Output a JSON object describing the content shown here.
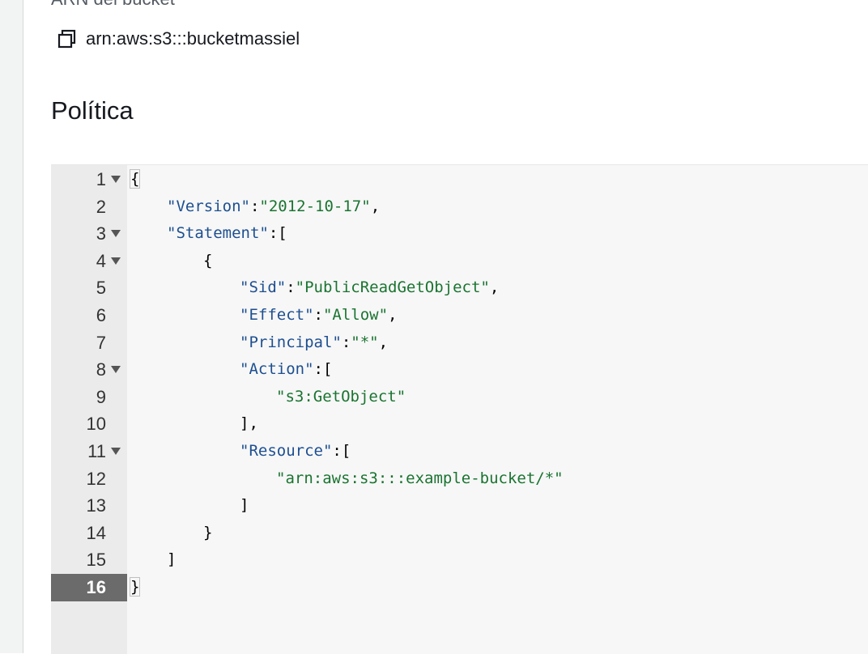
{
  "bucket_arn": {
    "label": "ARN del bucket",
    "value": "arn:aws:s3:::bucketmassiel",
    "copy_icon": "copy-icon"
  },
  "policy": {
    "title": "Política",
    "editor": {
      "active_line": 16,
      "lines": [
        {
          "n": "1",
          "fold": true,
          "indent": 0,
          "parts": [
            {
              "t": "{",
              "c": "brace"
            }
          ]
        },
        {
          "n": "2",
          "fold": false,
          "indent": 1,
          "parts": [
            {
              "t": "\"Version\"",
              "c": "key"
            },
            {
              "t": ":",
              "c": ""
            },
            {
              "t": "\"2012-10-17\"",
              "c": "str"
            },
            {
              "t": ",",
              "c": ""
            }
          ]
        },
        {
          "n": "3",
          "fold": true,
          "indent": 1,
          "parts": [
            {
              "t": "\"Statement\"",
              "c": "key"
            },
            {
              "t": ":[",
              "c": ""
            }
          ]
        },
        {
          "n": "4",
          "fold": true,
          "indent": 2,
          "parts": [
            {
              "t": "{",
              "c": ""
            }
          ]
        },
        {
          "n": "5",
          "fold": false,
          "indent": 3,
          "parts": [
            {
              "t": "\"Sid\"",
              "c": "key"
            },
            {
              "t": ":",
              "c": ""
            },
            {
              "t": "\"PublicReadGetObject\"",
              "c": "str"
            },
            {
              "t": ",",
              "c": ""
            }
          ]
        },
        {
          "n": "6",
          "fold": false,
          "indent": 3,
          "parts": [
            {
              "t": "\"Effect\"",
              "c": "key"
            },
            {
              "t": ":",
              "c": ""
            },
            {
              "t": "\"Allow\"",
              "c": "str"
            },
            {
              "t": ",",
              "c": ""
            }
          ]
        },
        {
          "n": "7",
          "fold": false,
          "indent": 3,
          "parts": [
            {
              "t": "\"Principal\"",
              "c": "key"
            },
            {
              "t": ":",
              "c": ""
            },
            {
              "t": "\"*\"",
              "c": "str"
            },
            {
              "t": ",",
              "c": ""
            }
          ]
        },
        {
          "n": "8",
          "fold": true,
          "indent": 3,
          "parts": [
            {
              "t": "\"Action\"",
              "c": "key"
            },
            {
              "t": ":[",
              "c": ""
            }
          ]
        },
        {
          "n": "9",
          "fold": false,
          "indent": 4,
          "parts": [
            {
              "t": "\"s3:GetObject\"",
              "c": "str"
            }
          ]
        },
        {
          "n": "10",
          "fold": false,
          "indent": 3,
          "parts": [
            {
              "t": "],",
              "c": ""
            }
          ]
        },
        {
          "n": "11",
          "fold": true,
          "indent": 3,
          "parts": [
            {
              "t": "\"Resource\"",
              "c": "key"
            },
            {
              "t": ":[",
              "c": ""
            }
          ]
        },
        {
          "n": "12",
          "fold": false,
          "indent": 4,
          "parts": [
            {
              "t": "\"arn:aws:s3:::example-bucket/*\"",
              "c": "str"
            }
          ]
        },
        {
          "n": "13",
          "fold": false,
          "indent": 3,
          "parts": [
            {
              "t": "]",
              "c": ""
            }
          ]
        },
        {
          "n": "14",
          "fold": false,
          "indent": 2,
          "parts": [
            {
              "t": "}",
              "c": ""
            }
          ]
        },
        {
          "n": "15",
          "fold": false,
          "indent": 1,
          "parts": [
            {
              "t": "]",
              "c": ""
            }
          ]
        },
        {
          "n": "16",
          "fold": false,
          "indent": 0,
          "parts": [
            {
              "t": "}",
              "c": "brace"
            }
          ]
        }
      ]
    }
  }
}
